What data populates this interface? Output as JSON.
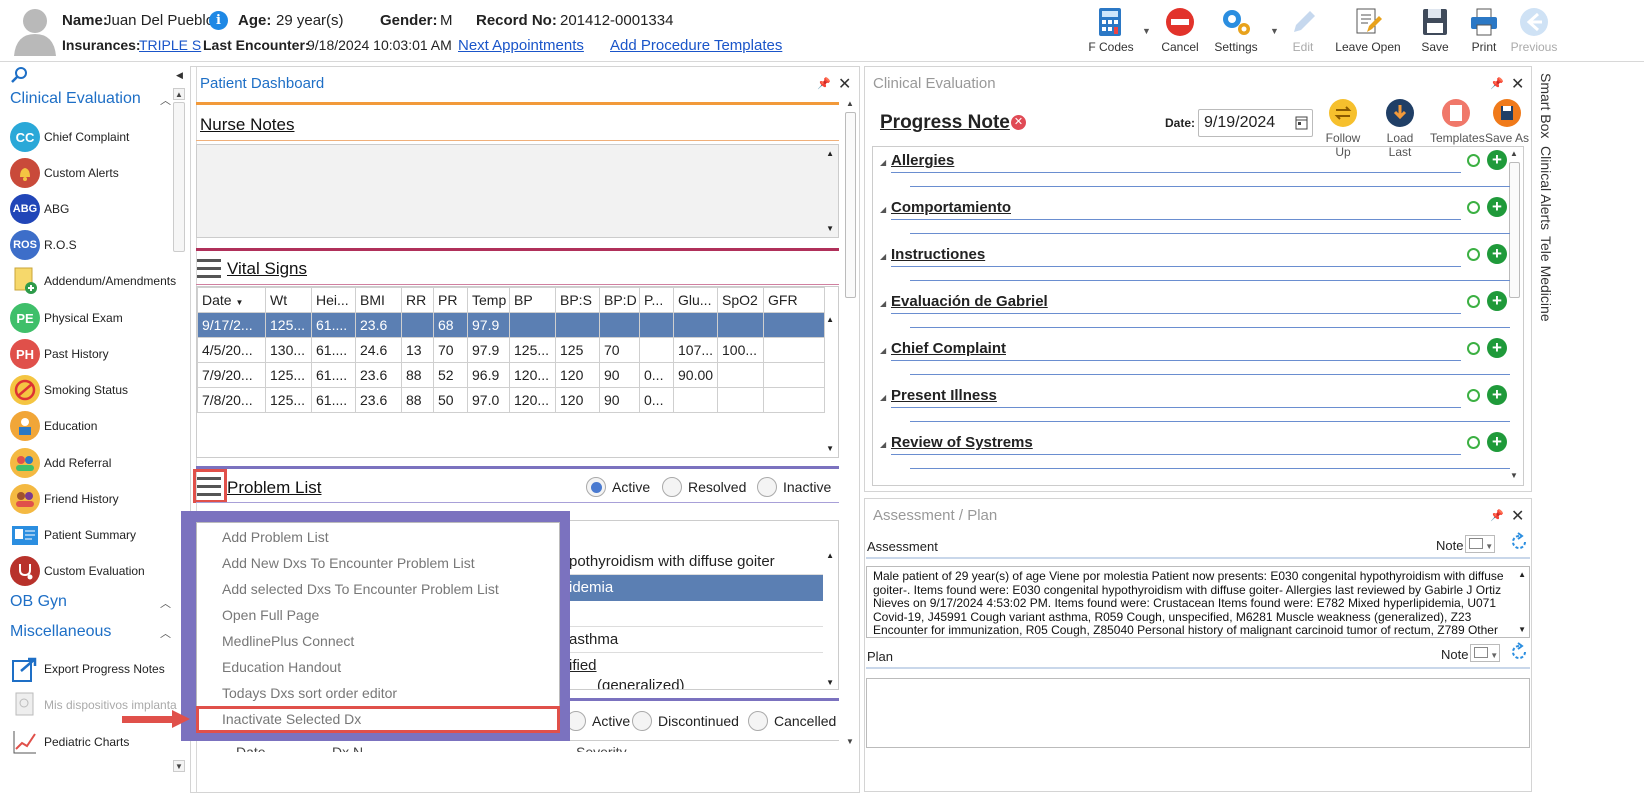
{
  "header": {
    "name_label": "Name:",
    "name_value": "Juan Del Pueblo",
    "age_label": "Age:",
    "age_value": "29 year(s)",
    "gender_label": "Gender:",
    "gender_value": "M",
    "record_label": "Record No:",
    "record_value": "201412-0001334",
    "insurances_label": "Insurances:",
    "insurances_value": "TRIPLE S",
    "last_encounter_label": "Last Encounter:",
    "last_encounter_value": "9/18/2024 10:03:01 AM",
    "next_appointments": "Next Appointments",
    "add_procedure_templates": "Add Procedure Templates",
    "info_glyph": "i"
  },
  "toolbar": {
    "fcodes": "F Codes",
    "cancel": "Cancel",
    "settings": "Settings",
    "edit": "Edit",
    "leave_open": "Leave Open",
    "save": "Save",
    "print": "Print",
    "previous": "Previous"
  },
  "sidebar": {
    "section_clinical": "Clinical Evaluation",
    "items_clinical": [
      {
        "label": "Chief Complaint",
        "icon": "CC"
      },
      {
        "label": "Custom Alerts",
        "icon": ""
      },
      {
        "label": "ABG",
        "icon": "ABG"
      },
      {
        "label": "R.O.S",
        "icon": "ROS"
      },
      {
        "label": "Addendum/Amendments",
        "icon": ""
      },
      {
        "label": "Physical Exam",
        "icon": "PE"
      },
      {
        "label": "Past History",
        "icon": "PH"
      },
      {
        "label": "Smoking Status",
        "icon": ""
      },
      {
        "label": "Education",
        "icon": ""
      },
      {
        "label": "Add Referral",
        "icon": ""
      },
      {
        "label": "Friend History",
        "icon": ""
      },
      {
        "label": "Patient Summary",
        "icon": ""
      },
      {
        "label": "Custom Evaluation",
        "icon": ""
      }
    ],
    "section_obgyn": "OB Gyn",
    "section_misc": "Miscellaneous",
    "items_misc": [
      {
        "label": "Export Progress Notes"
      },
      {
        "label": "Mis dispositivos implanta"
      },
      {
        "label": "Pediatric Charts"
      }
    ]
  },
  "dashboard": {
    "title": "Patient Dashboard",
    "nurse_notes": "Nurse Notes",
    "vital_signs": "Vital Signs",
    "vs_headers": [
      "Date",
      "Wt",
      "Hei...",
      "BMI",
      "RR",
      "PR",
      "Temp",
      "BP",
      "BP:S",
      "BP:D",
      "P...",
      "Glu...",
      "SpO2",
      "GFR"
    ],
    "vs_rows": [
      [
        "9/17/2...",
        "125...",
        "61....",
        "23.6",
        "",
        "68",
        "97.9",
        "",
        "",
        "",
        "",
        "",
        "",
        ""
      ],
      [
        "4/5/20...",
        "130...",
        "61....",
        "24.6",
        "13",
        "70",
        "97.9",
        "125...",
        "125",
        "70",
        "",
        "107...",
        "100...",
        ""
      ],
      [
        "7/9/20...",
        "125...",
        "61....",
        "23.6",
        "88",
        "52",
        "96.9",
        "120...",
        "120",
        "90",
        "0...",
        "90.00",
        "",
        ""
      ],
      [
        "7/8/20...",
        "125...",
        "61....",
        "23.6",
        "88",
        "50",
        "97.0",
        "120...",
        "120",
        "90",
        "0...",
        "",
        "",
        ""
      ]
    ],
    "problem_list": "Problem List",
    "radio_active": "Active",
    "radio_resolved": "Resolved",
    "radio_inactive": "Inactive",
    "problem_rows": [
      "pothyroidism with diffuse goiter",
      "idemia",
      "",
      "asthma",
      "ified",
      "(generalized)"
    ],
    "med_radio_active": "Active",
    "med_radio_discontinued": "Discontinued",
    "med_radio_cancelled": "Cancelled",
    "partial_headers": [
      "Date",
      "Dx N",
      "Severity"
    ]
  },
  "context_menu": {
    "items": [
      "Add Problem List",
      "Add New Dxs To Encounter Problem List",
      "Add selected Dxs To Encounter Problem List",
      "Open Full Page",
      "MedlinePlus Connect",
      "Education Handout",
      "Todays Dxs sort order editor",
      "Inactivate Selected Dx"
    ]
  },
  "clinical_eval": {
    "title": "Clinical Evaluation",
    "progress_note": "Progress Note",
    "date_label": "Date:",
    "date_value": "9/19/2024",
    "follow_up": "Follow Up",
    "load_last": "Load Last",
    "templates": "Templates",
    "save_as": "Save As",
    "sections": [
      "Allergies",
      "Comportamiento",
      "Instructiones",
      "Evaluación de Gabriel",
      "Chief Complaint",
      "Present Illness",
      "Review of Systrems"
    ]
  },
  "assessment_plan": {
    "title": "Assessment / Plan",
    "assessment_label": "Assessment",
    "note_label": "Note",
    "assessment_text": "Male patient of 29 year(s) of age Viene por molestia Patient now presents: E030 congenital hypothyroidism with diffuse goiter-. Items found were: E030 congenital hypothyroidism with diffuse goiter-   Allergies last reviewed by Gabirle J Ortiz Nieves on 9/17/2024 4:53:02 PM.    Items found were:  Crustacean  Items found were:  E782 Mixed hyperlipidemia, U071 Covid-19, J45991 Cough variant asthma, R059 Cough, unspecified, M6281 Muscle weakness (generalized), Z23 Encounter for immunization, R05 Cough, Z85040 Personal history of malignant carcinoid tumor of rectum, Z789 Other",
    "plan_label": "Plan",
    "plan_note_label": "Note"
  },
  "right_tabs": {
    "smart_box": "Smart Box",
    "clinical_alerts": "Clinical Alerts",
    "tele_medicine": "Tele Medicine"
  },
  "colors": {
    "accent_blue": "#1e6fc6",
    "selected_row": "#5b7fb3",
    "menu_purple": "#7b72bf",
    "highlight_red": "#e0504a",
    "orange_rule": "#f29a3a",
    "magenta_rule": "#b0305a",
    "purple_rule": "#7b72bf"
  }
}
